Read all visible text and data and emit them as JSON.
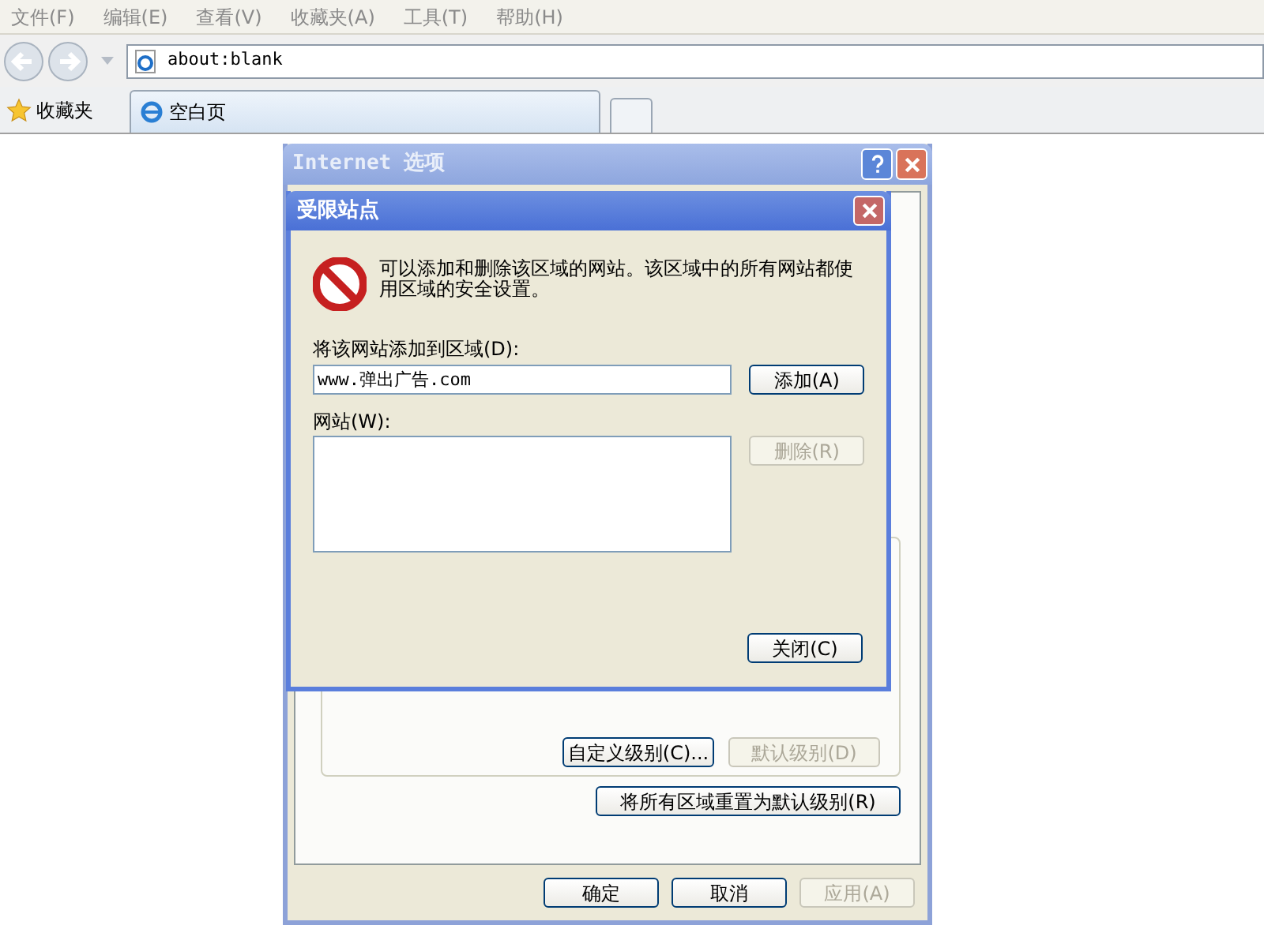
{
  "menu": [
    {
      "label": "文件(F)"
    },
    {
      "label": "编辑(E)"
    },
    {
      "label": "查看(V)"
    },
    {
      "label": "收藏夹(A)"
    },
    {
      "label": "工具(T)"
    },
    {
      "label": "帮助(H)"
    }
  ],
  "address_bar": {
    "url": "about:blank"
  },
  "favorites_bar": {
    "label": "收藏夹",
    "tabs": [
      {
        "label": "空白页",
        "selected": true
      }
    ]
  },
  "options_dialog": {
    "title": "Internet 选项",
    "zone_buttons": [
      {
        "label": "自定义级别(C)...",
        "disabled": false
      },
      {
        "label": "默认级别(D)",
        "disabled": true
      }
    ],
    "reset_button": {
      "label": "将所有区域重置为默认级别(R)",
      "disabled": false
    },
    "buttons": [
      {
        "label": "确定",
        "disabled": false
      },
      {
        "label": "取消",
        "disabled": false
      },
      {
        "label": "应用(A)",
        "disabled": true
      }
    ]
  },
  "zone_dialog": {
    "title": "受限站点",
    "message": "可以添加和删除该区域的网站。该区域中的所有网站都使用区域的安全设置。",
    "add_label": "将该网站添加到区域(D):",
    "add_field": {
      "value": "www.弹出广告.com"
    },
    "add_button": {
      "label": "添加(A)",
      "disabled": false
    },
    "websites_label": "网站(W):",
    "remove_button": {
      "label": "删除(R)",
      "disabled": true
    },
    "close_button": {
      "label": "关闭(C)",
      "disabled": false
    }
  }
}
